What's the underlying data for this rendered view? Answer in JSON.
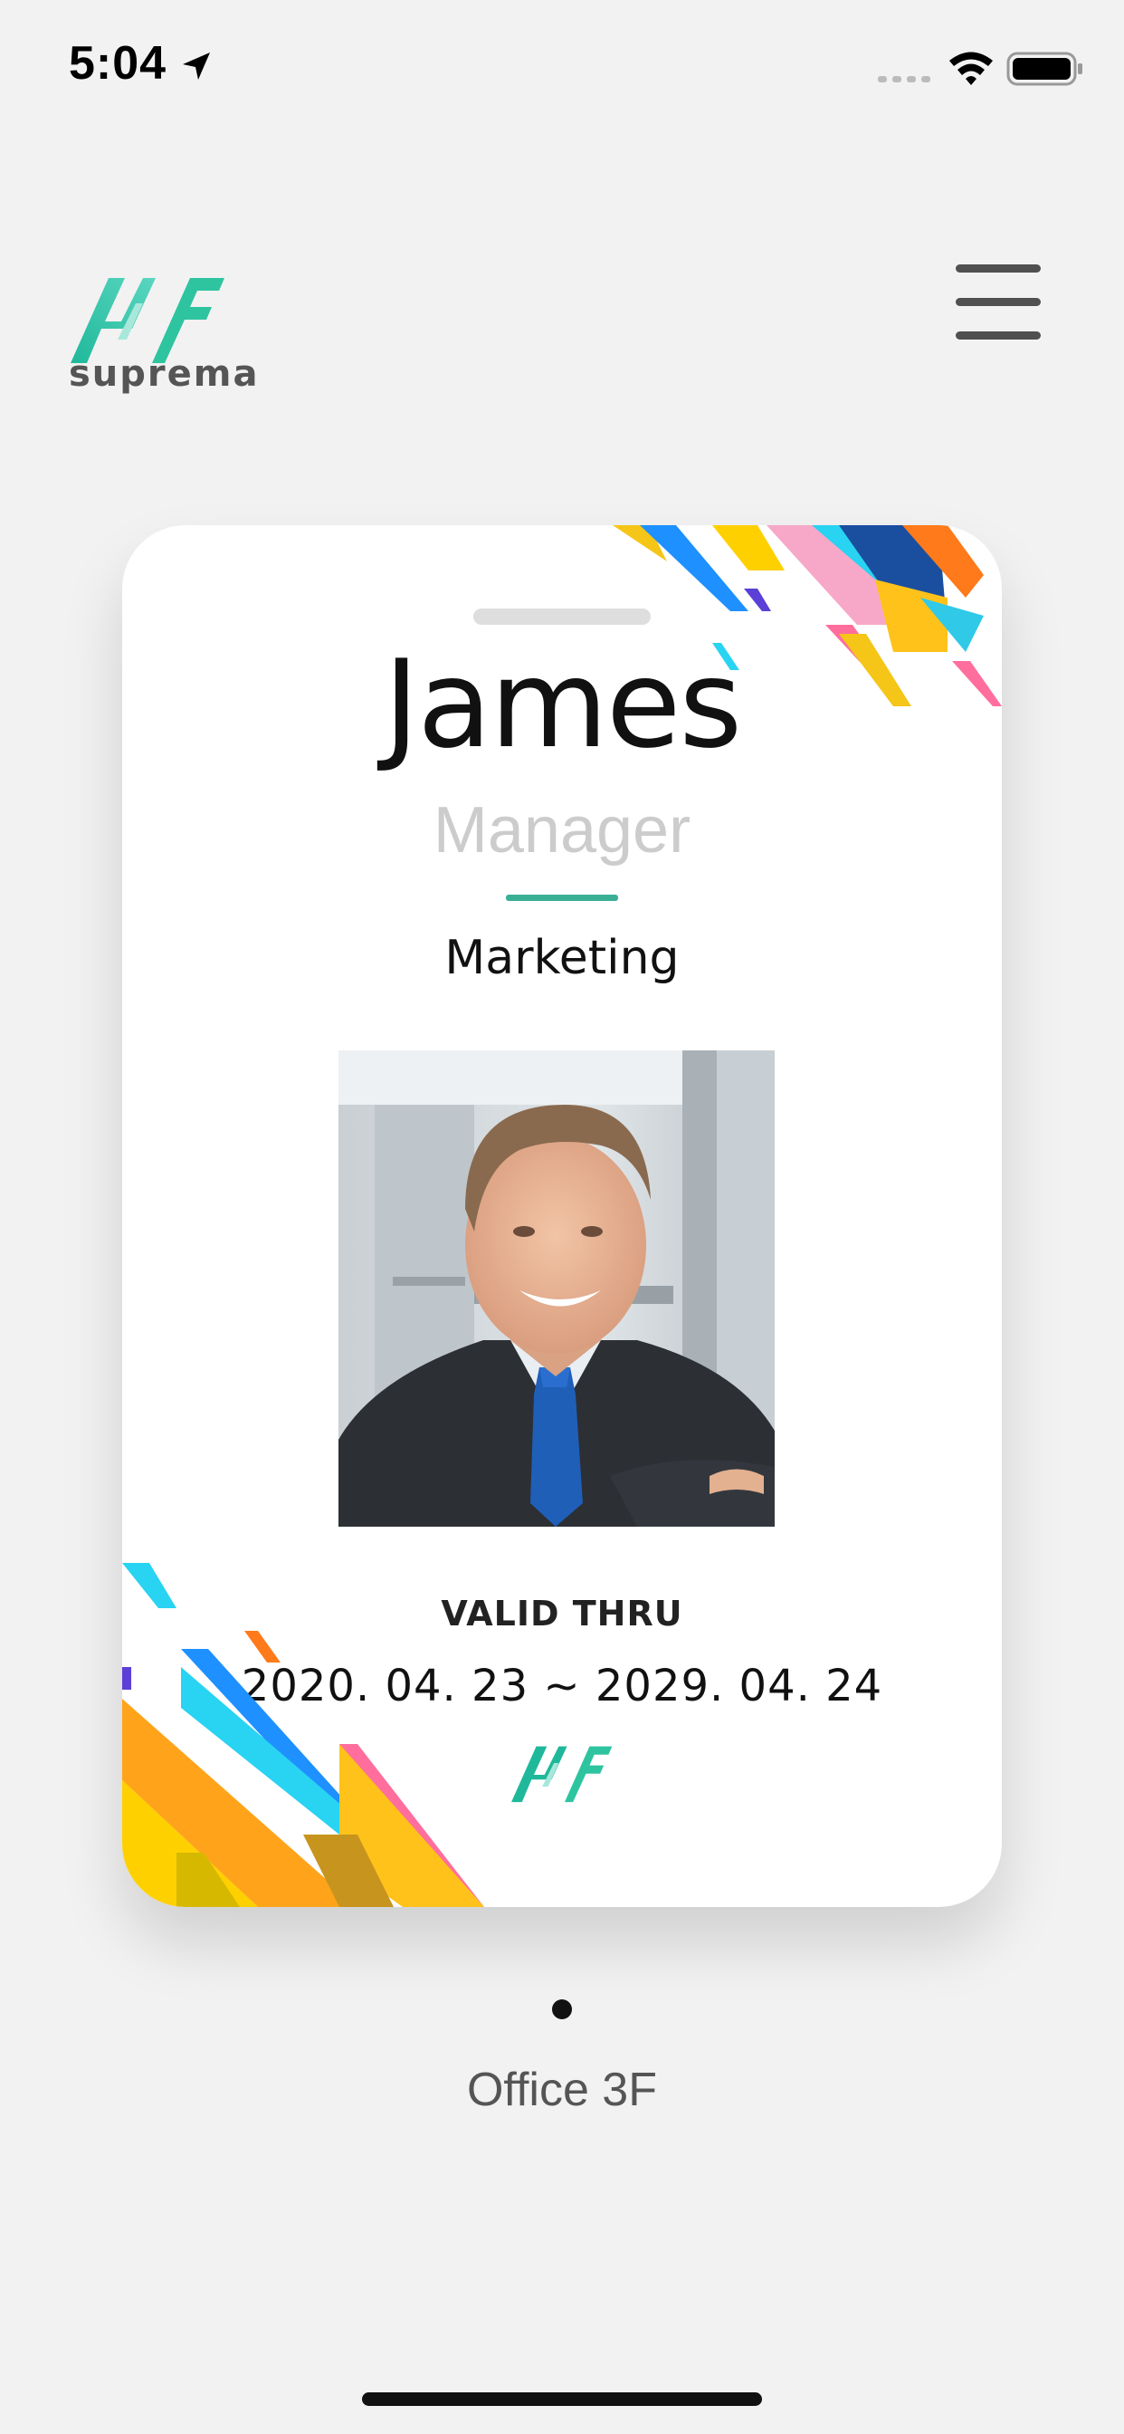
{
  "status_bar": {
    "time": "5:04"
  },
  "header": {
    "brand": "suprema"
  },
  "card": {
    "name": "James",
    "role": "Manager",
    "department": "Marketing",
    "valid_label": "VALID THRU",
    "valid_dates": "2020. 04. 23 ~ 2029. 04. 24"
  },
  "location": "Office 3F",
  "pagination": {
    "current": 1,
    "total": 1
  },
  "colors": {
    "accent": "#3aaf96",
    "logo_green": "#2ec4a0",
    "background": "#f2f2f2"
  },
  "icons": {
    "menu": "hamburger-icon",
    "location_arrow": "location-arrow-icon",
    "wifi": "wifi-icon",
    "battery": "battery-icon"
  }
}
